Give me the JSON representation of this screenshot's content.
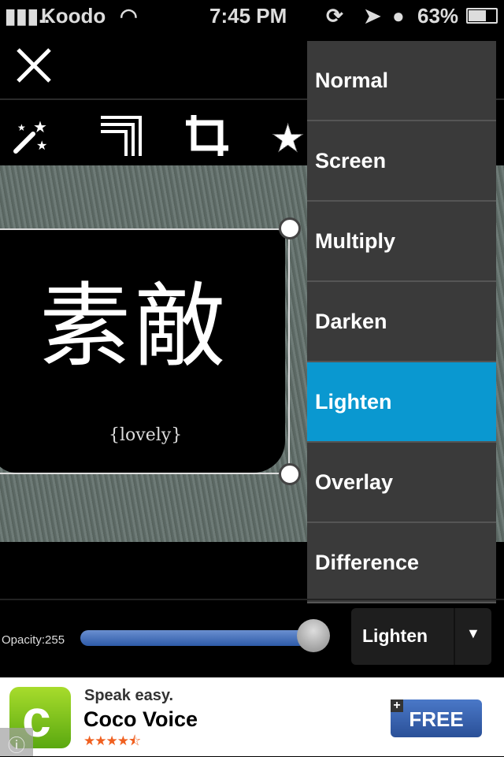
{
  "status_bar": {
    "carrier": "Koodo",
    "time": "7:45 PM",
    "battery": "63%"
  },
  "toolbar": {
    "icons": [
      "magic-wand-icon",
      "frames-icon",
      "crop-icon",
      "sticker-star-icon"
    ]
  },
  "canvas": {
    "sticker_text": "素敵",
    "sticker_caption": "{lovely}"
  },
  "blend_menu": {
    "items": [
      "Normal",
      "Screen",
      "Multiply",
      "Darken",
      "Lighten",
      "Overlay",
      "Difference"
    ],
    "selected": "Lighten",
    "selected_color": "#0a98d0"
  },
  "opacity": {
    "label": "Opacity:255",
    "value": 255,
    "max": 255
  },
  "blend_select": {
    "value": "Lighten",
    "arrow": "▼"
  },
  "ad": {
    "tagline": "Speak easy.",
    "app_name": "Coco Voice",
    "rating": 4.5,
    "stars": "★★★★⯪",
    "button": "FREE"
  }
}
